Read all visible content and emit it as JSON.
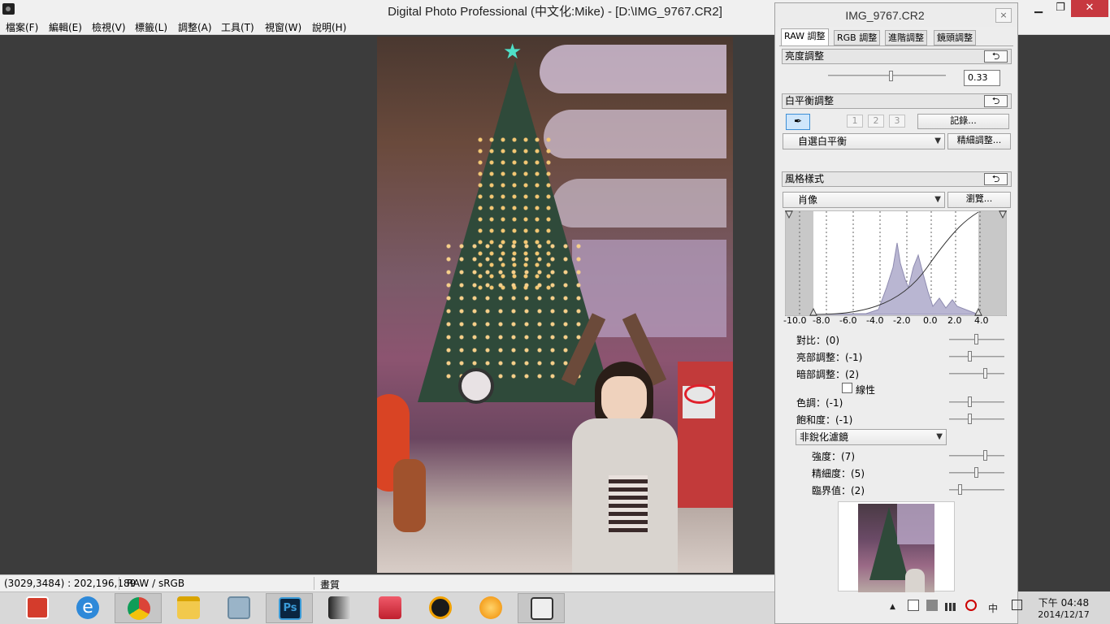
{
  "window": {
    "title": "Digital Photo Professional (中文化:Mike) - [D:\\IMG_9767.CR2]",
    "min": "▁",
    "max": "❐",
    "close": "✕"
  },
  "menu": [
    "檔案(F)",
    "編輯(E)",
    "檢視(V)",
    "標籤(L)",
    "調整(A)",
    "工具(T)",
    "視窗(W)",
    "說明(H)"
  ],
  "status": {
    "coords": "(3029,3484) : 202,196,189",
    "color": "RAW / sRGB",
    "quality": "畫質"
  },
  "panel": {
    "title": "IMG_9767.CR2",
    "close": "×",
    "tabs": [
      "RAW 調整",
      "RGB 調整",
      "進階調整",
      "鏡頭調整"
    ],
    "reset_glyph": "⮌",
    "brightness": {
      "label": "亮度調整",
      "value": "0.33",
      "level": 0.54
    },
    "white_balance": {
      "label": "白平衡調整",
      "eyedropper_icon": "eyedropper-icon",
      "presets": [
        "1",
        "2",
        "3"
      ],
      "record": "記錄...",
      "mode": "自選白平衡",
      "fine_tune": "精細調整..."
    },
    "picture_style": {
      "label": "風格樣式",
      "style": "肖像",
      "browse": "瀏覽...",
      "axis": [
        "-10.0",
        "-8.0",
        "-6.0",
        "-4.0",
        "-2.0",
        "0.0",
        "2.0",
        "4.0"
      ],
      "contrast": {
        "label": "對比：(0)",
        "level": 0.5
      },
      "highlight": {
        "label": "亮部調整：(-1)",
        "level": 0.38
      },
      "shadow": {
        "label": "暗部調整：(2)",
        "level": 0.66
      },
      "linear": "線性",
      "tone": {
        "label": "色調：(-1)",
        "level": 0.38
      },
      "saturation": {
        "label": "飽和度：(-1)",
        "level": 0.38
      },
      "sharpen_mode": "非銳化濾鏡",
      "strength": {
        "label": "強度：(7)",
        "level": 0.66
      },
      "fineness": {
        "label": "精細度：(5)",
        "level": 0.5
      },
      "threshold": {
        "label": "臨界值：(2)",
        "level": 0.2
      }
    }
  },
  "taskbar": {
    "apps": [
      "power-app-icon",
      "ie-icon",
      "chrome-icon",
      "file-explorer-icon",
      "calculator-icon",
      "photoshop-icon",
      "portrait-app-icon",
      "media-app-icon",
      "sketch-app-icon",
      "orange-app-icon",
      "dpp-app-icon"
    ],
    "photoshop_label": "Ps",
    "tray": {
      "up_arrow": "▲",
      "ime": "中",
      "time": "下午 04:48",
      "date": "2014/12/17"
    }
  }
}
